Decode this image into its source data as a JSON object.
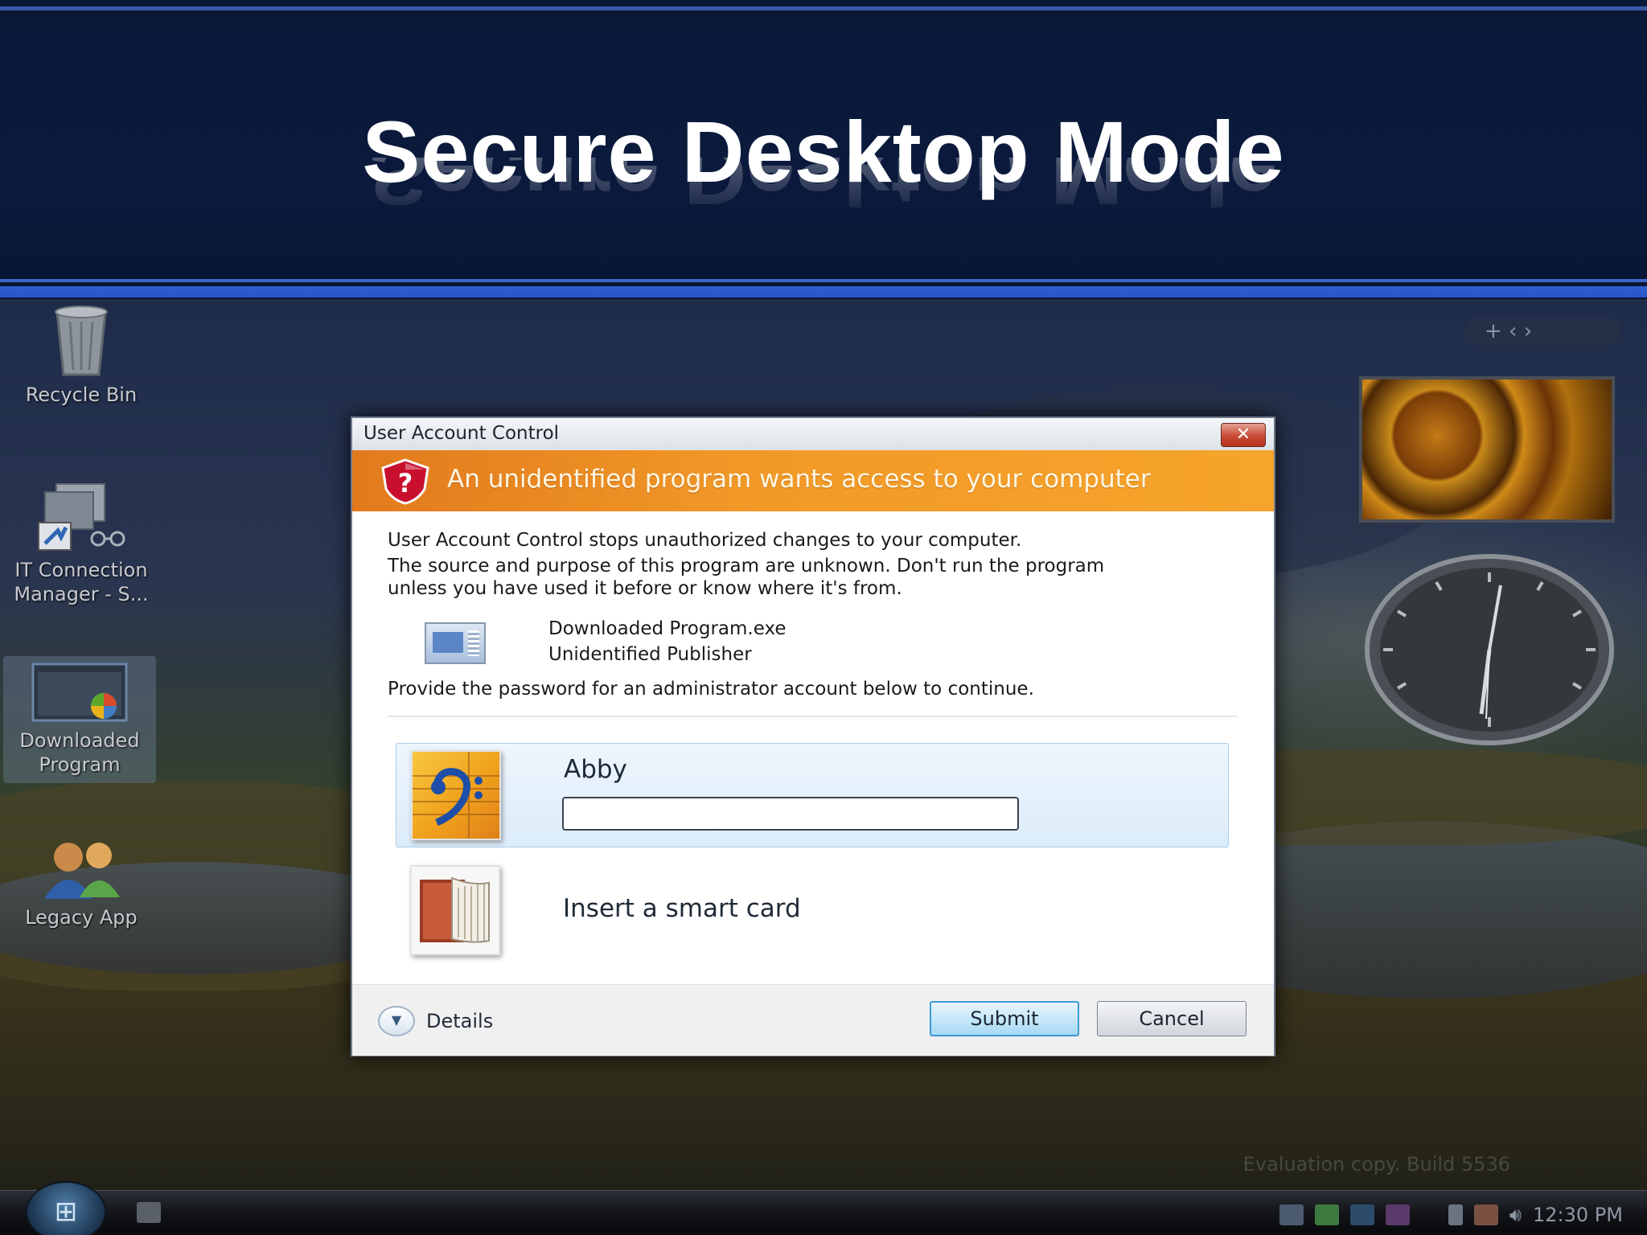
{
  "slide": {
    "title": "Secure Desktop Mode"
  },
  "desktop": {
    "icons": [
      {
        "label": "Recycle Bin"
      },
      {
        "label": "IT Connection Manager - S..."
      },
      {
        "label": "Downloaded Program"
      },
      {
        "label": "Legacy App"
      }
    ],
    "gadget_controls": "+ ‹ › ",
    "watermark": "Evaluation copy. Build 5536",
    "tray_clock": "12:30 PM"
  },
  "dialog": {
    "window_title": "User Account Control",
    "close_glyph": "✕",
    "banner_text": "An unidentified program wants access to your computer",
    "intro_line": "User Account Control stops unauthorized changes to your computer.",
    "warning_line1": "The source and purpose of this program are unknown.  Don't run the program",
    "warning_line2": "unless you have used it before or know where it's from.",
    "program_name": "Downloaded Program.exe",
    "publisher": "Unidentified Publisher",
    "prompt": "Provide the password for an administrator account below to continue.",
    "credential": {
      "user_name": "Abby",
      "password_value": "",
      "icon": "music-clef-icon"
    },
    "smart_card": {
      "label": "Insert a smart card",
      "icon": "smart-card-book-icon"
    },
    "footer": {
      "details_label": "Details",
      "submit_label": "Submit",
      "cancel_label": "Cancel"
    }
  },
  "colors": {
    "banner": "#f29a28",
    "header_bg": "#0b1a3c",
    "accent_line": "#2f5fd0"
  }
}
